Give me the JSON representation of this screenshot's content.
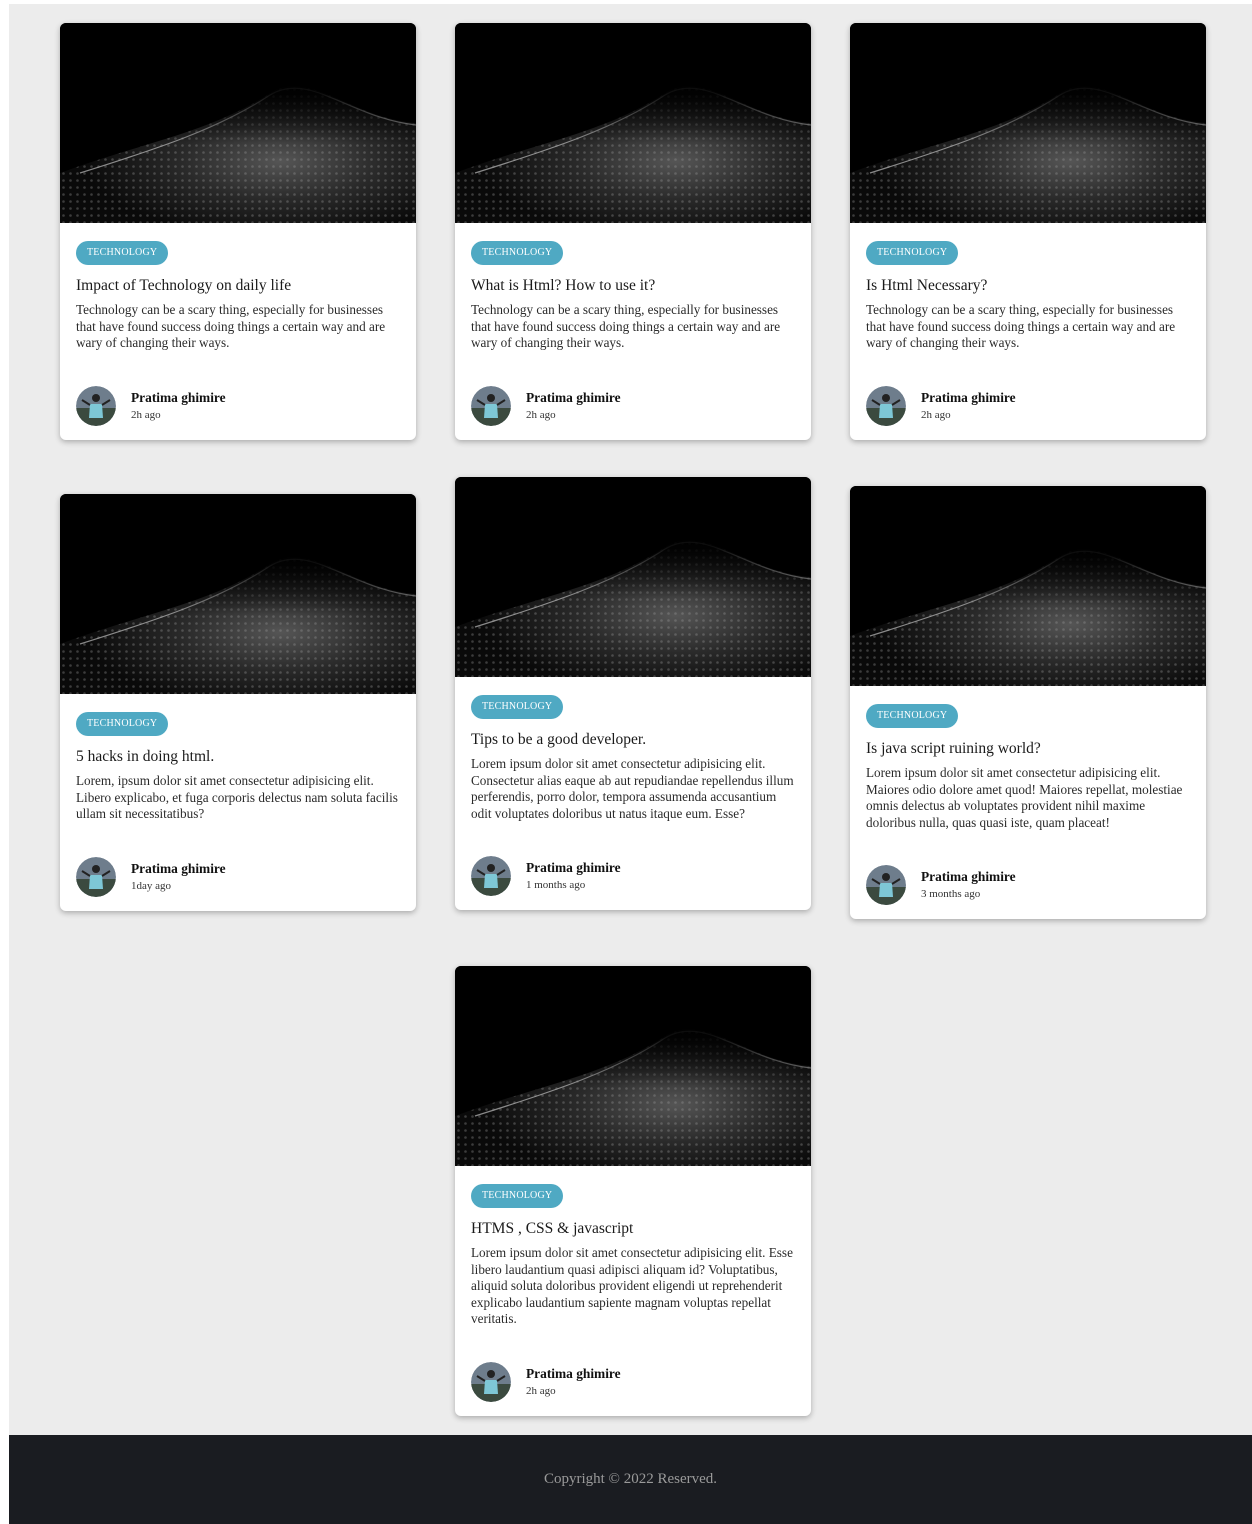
{
  "posts": [
    {
      "tag": "TECHNOLOGY",
      "title": "Impact of Technology on daily life",
      "text": "Technology can be a scary thing, especially for businesses that have found success doing things a certain way and are wary of changing their ways.",
      "author": "Pratima ghimire",
      "time": "2h ago"
    },
    {
      "tag": "TECHNOLOGY",
      "title": "What is Html? How to use it?",
      "text": "Technology can be a scary thing, especially for businesses that have found success doing things a certain way and are wary of changing their ways.",
      "author": "Pratima ghimire",
      "time": "2h ago"
    },
    {
      "tag": "TECHNOLOGY",
      "title": "Is Html Necessary?",
      "text": "Technology can be a scary thing, especially for businesses that have found success doing things a certain way and are wary of changing their ways.",
      "author": "Pratima ghimire",
      "time": "2h ago"
    },
    {
      "tag": "TECHNOLOGY",
      "title": "5 hacks in doing html.",
      "text": "Lorem, ipsum dolor sit amet consectetur adipisicing elit. Libero explicabo, et fuga corporis delectus nam soluta facilis ullam sit necessitatibus?",
      "author": "Pratima ghimire",
      "time": "1day ago"
    },
    {
      "tag": "TECHNOLOGY",
      "title": "Tips to be a good developer.",
      "text": "Lorem ipsum dolor sit amet consectetur adipisicing elit. Consectetur alias eaque ab aut repudiandae repellendus illum perferendis, porro dolor, tempora assumenda accusantium odit voluptates doloribus ut natus itaque eum. Esse?",
      "author": "Pratima ghimire",
      "time": "1 months ago"
    },
    {
      "tag": "TECHNOLOGY",
      "title": "Is java script ruining world?",
      "text": "Lorem ipsum dolor sit amet consectetur adipisicing elit. Maiores odio dolore amet quod! Maiores repellat, molestiae omnis delectus ab voluptates provident nihil maxime doloribus nulla, quas quasi iste, quam placeat!",
      "author": "Pratima ghimire",
      "time": "3 months ago"
    },
    {
      "tag": "TECHNOLOGY",
      "title": "HTMS , CSS & javascript",
      "text": "Lorem ipsum dolor sit amet consectetur adipisicing elit. Esse libero laudantium quasi adipisci aliquam id? Voluptatibus, aliquid soluta doloribus provident eligendi ut reprehenderit explicabo laudantium sapiente magnam voluptas repellat veritatis.",
      "author": "Pratima ghimire",
      "time": "2h ago"
    }
  ],
  "footer": {
    "copyright": "Copyright © 2022 Reserved."
  },
  "colors": {
    "background": "#ececec",
    "tag": "#4fa9c3",
    "footer": "#1a1c21"
  }
}
